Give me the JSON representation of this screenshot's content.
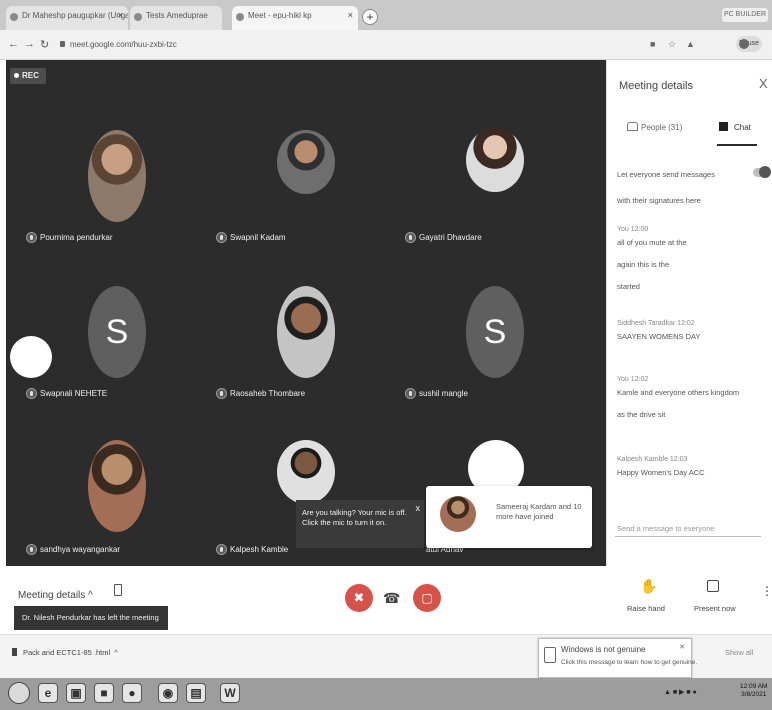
{
  "browser": {
    "tabs": [
      {
        "label": "Dr Maheshp paugupkar (Ungaud)"
      },
      {
        "label": "Tests Ameduprae"
      },
      {
        "label": "Meet - epu-hikl kp"
      }
    ],
    "new_tab": "+",
    "profile": "PC BUILDER",
    "url": "meet.google.com/huu-zxbi-tzc",
    "avatar_label": "Pause"
  },
  "stage": {
    "rec_label": "REC",
    "participants": [
      {
        "name": "Pournima pendurkar",
        "avatar": "photo"
      },
      {
        "name": "Swapnil Kadam",
        "avatar": "photo"
      },
      {
        "name": "Gayatri Dhavdare",
        "avatar": "photo"
      },
      {
        "name": "Swapnali NEHETE",
        "avatar": "letter",
        "letter": "S"
      },
      {
        "name": "Raosaheb Thombare",
        "avatar": "photo"
      },
      {
        "name": "sushil mangle",
        "avatar": "letter",
        "letter": "S"
      },
      {
        "name": "sandhya wayangankar",
        "avatar": "photo"
      },
      {
        "name": "Kalpesh Kamble",
        "avatar": "photo"
      },
      {
        "name": "atul Adhav"
      }
    ],
    "talking_popup": {
      "text": "Are you talking? Your mic is off. Click the mic to turn it on.",
      "close": "x"
    },
    "join_popup": {
      "text": "Sameeraj Kardam and 10 more have joined"
    }
  },
  "panel": {
    "title": "Meeting details",
    "close": "X",
    "tab_people": "People (31)",
    "tab_chat": "Chat",
    "messages": [
      {
        "text": "Let everyone send messages"
      },
      {
        "text": "with their signatures here"
      },
      {
        "author": "You  12:00",
        "lines": [
          "all of you mute at the",
          "again this is the",
          "started"
        ]
      },
      {
        "author": "Siddhesh Taradkar  12:02",
        "lines": [
          "SAAYEN WOMENS DAY"
        ]
      },
      {
        "author": "You  12:02",
        "lines": [
          "Kamle and everyone others kingdom",
          "as the drive sit"
        ]
      },
      {
        "author": "Kalpesh Kamble  12:03",
        "lines": [
          "Happy Women's Day ACC"
        ]
      }
    ],
    "input_placeholder": "Send a message to everyone"
  },
  "controls": {
    "meeting_details": "Meeting details",
    "meeting_details_chevron": "^",
    "snackbar": "Dr. Nilesh Pendurkar has left the meeting",
    "mic_icon": "✖",
    "hangup_icon": "☎",
    "cam_icon": "▢",
    "raise_hand": "Raise hand",
    "present_now": "Present now",
    "more": "⋮"
  },
  "downloads": {
    "file": "Pack and ECTC1-85 .html",
    "chevron": "^",
    "show_all": "Show all",
    "windows_notice_title": "Windows is not genuine",
    "windows_notice_sub": "Click this message to learn how to get genuine."
  },
  "taskbar": {
    "apps": [
      "e",
      "▣",
      "■",
      "●",
      "◉",
      "▤",
      "W"
    ],
    "clock_time": "12:09 AM",
    "clock_date": "3/8/2021"
  }
}
